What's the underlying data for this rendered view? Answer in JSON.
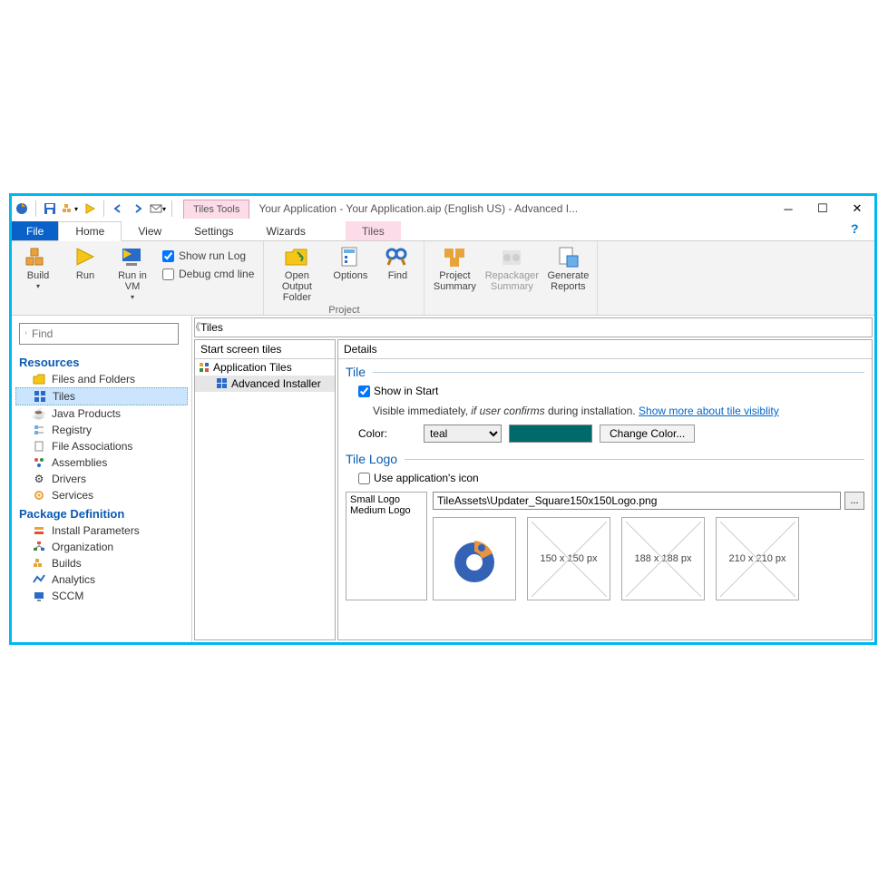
{
  "titlebar": {
    "title": "Your Application - Your Application.aip (English US) - Advanced I...",
    "tiles_tools": "Tiles Tools"
  },
  "ribbon_tabs": {
    "file": "File",
    "home": "Home",
    "view": "View",
    "settings": "Settings",
    "wizards": "Wizards",
    "tiles": "Tiles"
  },
  "ribbon": {
    "build": "Build",
    "run": "Run",
    "run_in_vm": "Run in VM",
    "show_run_log": "Show run Log",
    "debug_cmd": "Debug cmd line",
    "open_output": "Open Output Folder",
    "options": "Options",
    "find": "Find",
    "project_summary": "Project Summary",
    "repackager_summary": "Repackager Summary",
    "generate_reports": "Generate Reports",
    "group_project": "Project"
  },
  "left": {
    "find_placeholder": "Find",
    "resources_header": "Resources",
    "package_header": "Package Definition",
    "items": {
      "files": "Files and Folders",
      "tiles": "Tiles",
      "java": "Java Products",
      "registry": "Registry",
      "file_assoc": "File Associations",
      "assemblies": "Assemblies",
      "drivers": "Drivers",
      "services": "Services",
      "install_params": "Install Parameters",
      "organization": "Organization",
      "builds": "Builds",
      "analytics": "Analytics",
      "sccm": "SCCM"
    }
  },
  "content": {
    "tiles_label": "Tiles",
    "start_header": "Start screen tiles",
    "application_tiles": "Application Tiles",
    "advanced_installer": "Advanced Installer",
    "details_header": "Details",
    "tile_section": "Tile",
    "show_in_start": "Show in Start",
    "visibility_prefix": "Visible immediately, ",
    "visibility_italic": "if user confirms",
    "visibility_suffix": " during installation. ",
    "visibility_link": "Show more about tile visiblity",
    "color_label": "Color:",
    "color_value": "teal",
    "change_color": "Change Color...",
    "tile_logo_section": "Tile Logo",
    "use_app_icon": "Use application's icon",
    "small_logo": "Small Logo",
    "medium_logo": "Medium Logo",
    "logo_path": "TileAssets\\Updater_Square150x150Logo.png",
    "sizes": {
      "150": "150 x 150 px",
      "188": "188 x 188 px",
      "210": "210 x 210 px"
    }
  }
}
